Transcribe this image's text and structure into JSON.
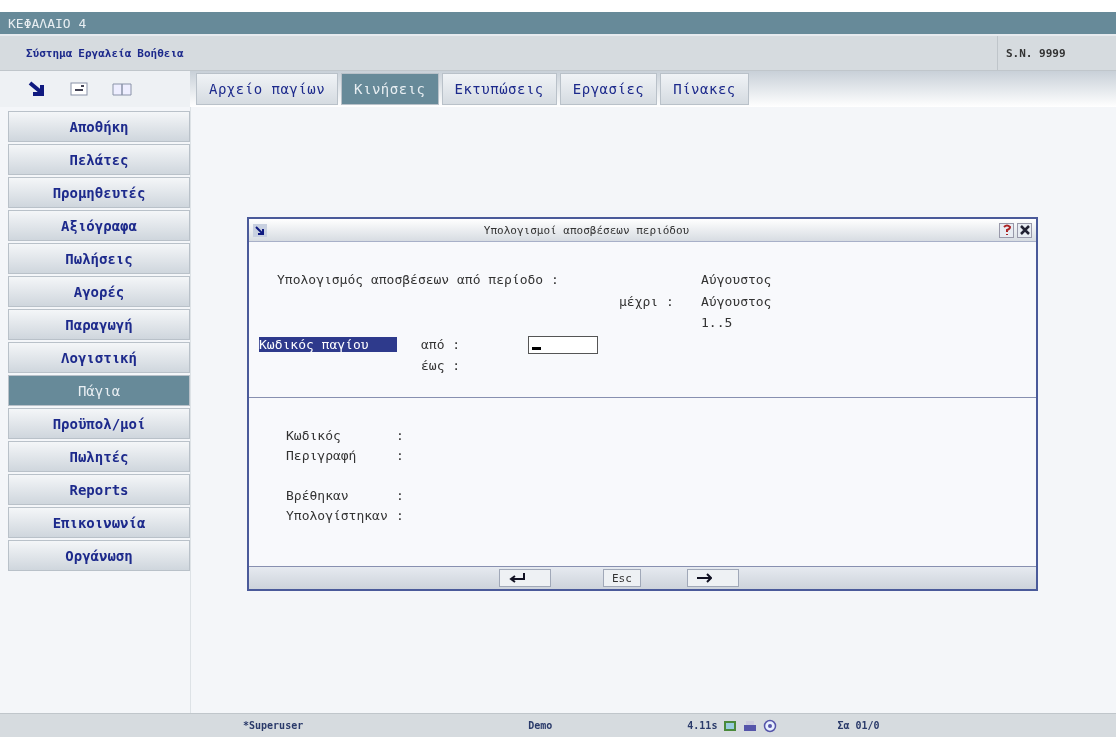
{
  "window": {
    "title": "ΚΕΦΑΛΑΙΟ 4"
  },
  "menu": [
    "Σύστημα",
    "Εργαλεία",
    "Βοήθεια"
  ],
  "serial": "S.N. 9999",
  "tabs": [
    {
      "label": "Αρχείο παγίων",
      "selected": false
    },
    {
      "label": "Κινήσεις",
      "selected": true
    },
    {
      "label": "Εκτυπώσεις",
      "selected": false
    },
    {
      "label": "Εργασίες",
      "selected": false
    },
    {
      "label": "Πίνακες",
      "selected": false
    }
  ],
  "sidebar": {
    "items": [
      {
        "label": "Αποθήκη",
        "selected": false
      },
      {
        "label": "Πελάτες",
        "selected": false
      },
      {
        "label": "Προμηθευτές",
        "selected": false
      },
      {
        "label": "Αξιόγραφα",
        "selected": false
      },
      {
        "label": "Πωλήσεις",
        "selected": false
      },
      {
        "label": "Αγορές",
        "selected": false
      },
      {
        "label": "Παραγωγή",
        "selected": false
      },
      {
        "label": "Λογιστική",
        "selected": false
      },
      {
        "label": "Πάγια",
        "selected": true
      },
      {
        "label": "Προϋπολ/μοί",
        "selected": false
      },
      {
        "label": "Πωλητές",
        "selected": false
      },
      {
        "label": "Reports",
        "selected": false
      },
      {
        "label": "Επικοινωνία",
        "selected": false
      },
      {
        "label": "Οργάνωση",
        "selected": false
      }
    ]
  },
  "dialog": {
    "title": "Υπολογισμοί αποσβέσεων περιόδου",
    "period_label": "Υπολογισμός αποσβέσεων από περίοδο :",
    "period_from": "Αύγουστος",
    "until_label": "μέχρι :",
    "period_to": "Αύγουστος",
    "range": "1..5",
    "code_label": {
      "text": "Κωδικός παγίου",
      "highlighted": true
    },
    "from_label": "από :",
    "to_label": "έως :",
    "info": [
      {
        "label": "Κωδικός",
        "value": ":"
      },
      {
        "label": "Περιγραφή",
        "value": ":"
      },
      {
        "label": "Βρέθηκαν",
        "value": ":"
      },
      {
        "label": "Υπολογίστηκαν",
        "value": ":"
      }
    ],
    "buttons": [
      {
        "kind": "enter"
      },
      {
        "kind": "text",
        "label": "Esc"
      },
      {
        "kind": "next"
      }
    ]
  },
  "status_bar": {
    "user": "*Superuser",
    "company": "Demo",
    "timing": "4.11s",
    "date": "Σα 01/0"
  }
}
